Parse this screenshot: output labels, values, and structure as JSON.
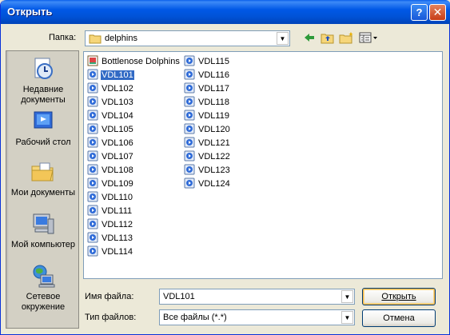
{
  "window": {
    "title": "Открыть"
  },
  "titlebar_buttons": {
    "help": "?",
    "close": "✕"
  },
  "folder": {
    "label": "Папка:",
    "value": "delphins"
  },
  "places": [
    {
      "label": "Недавние документы",
      "icon": "recent-documents-icon"
    },
    {
      "label": "Рабочий стол",
      "icon": "desktop-icon"
    },
    {
      "label": "Мои документы",
      "icon": "my-documents-icon"
    },
    {
      "label": "Мой компьютер",
      "icon": "my-computer-icon"
    },
    {
      "label": "Сетевое окружение",
      "icon": "network-places-icon"
    }
  ],
  "files": {
    "column1": [
      "Bottlenose Dolphins",
      "VDL101",
      "VDL102",
      "VDL103",
      "VDL104",
      "VDL105",
      "VDL106",
      "VDL107",
      "VDL108",
      "VDL109",
      "VDL110",
      "VDL111",
      "VDL112",
      "VDL113",
      "VDL114"
    ],
    "column2": [
      "VDL115",
      "VDL116",
      "VDL117",
      "VDL118",
      "VDL119",
      "VDL120",
      "VDL121",
      "VDL122",
      "VDL123",
      "VDL124"
    ],
    "selected": "VDL101"
  },
  "filename": {
    "label": "Имя файла:",
    "value": "VDL101"
  },
  "filetype": {
    "label": "Тип файлов:",
    "value": "Все файлы (*.*)"
  },
  "buttons": {
    "open": "Открыть",
    "cancel": "Отмена"
  },
  "colors": {
    "titlebar": "#0058e6",
    "selection": "#316ac5",
    "background": "#ece9d8"
  }
}
